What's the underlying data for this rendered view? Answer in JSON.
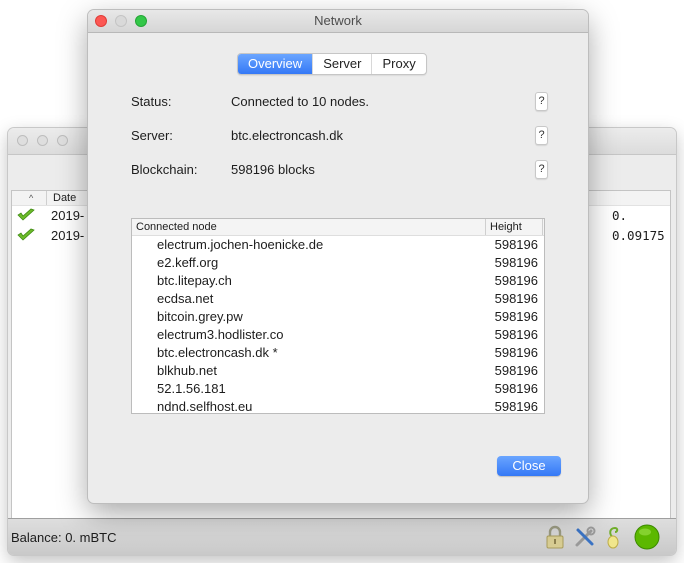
{
  "main_window": {
    "table": {
      "sort_indicator": "^",
      "columns": [
        "Date"
      ],
      "rows": [
        {
          "status_icon": "check-icon",
          "date": "2019-",
          "amount": "0."
        },
        {
          "status_icon": "check-icon",
          "date": "2019-",
          "amount": "0.09175"
        }
      ]
    },
    "status_bar": {
      "balance": "Balance: 0. mBTC",
      "icons": [
        "lock-icon",
        "tools-icon",
        "seed-icon",
        "network-status-icon"
      ]
    }
  },
  "dialog": {
    "title": "Network",
    "tabs": [
      {
        "label": "Overview",
        "active": true
      },
      {
        "label": "Server",
        "active": false
      },
      {
        "label": "Proxy",
        "active": false
      }
    ],
    "info": [
      {
        "label": "Status:",
        "value": "Connected to 10 nodes.",
        "help": "?"
      },
      {
        "label": "Server:",
        "value": "btc.electroncash.dk",
        "help": "?"
      },
      {
        "label": "Blockchain:",
        "value": "598196 blocks",
        "help": "?"
      }
    ],
    "nodes_table": {
      "columns": [
        "Connected node",
        "Height"
      ],
      "rows": [
        {
          "node": "electrum.jochen-hoenicke.de",
          "height": "598196"
        },
        {
          "node": "e2.keff.org",
          "height": "598196"
        },
        {
          "node": "btc.litepay.ch",
          "height": "598196"
        },
        {
          "node": "ecdsa.net",
          "height": "598196"
        },
        {
          "node": "bitcoin.grey.pw",
          "height": "598196"
        },
        {
          "node": "electrum3.hodlister.co",
          "height": "598196"
        },
        {
          "node": "btc.electroncash.dk *",
          "height": "598196"
        },
        {
          "node": "blkhub.net",
          "height": "598196"
        },
        {
          "node": "52.1.56.181",
          "height": "598196"
        },
        {
          "node": "ndnd.selfhost.eu",
          "height": "598196"
        }
      ]
    },
    "close_label": "Close"
  },
  "colors": {
    "accent": "#3478f6",
    "traffic_close": "#fc5753",
    "traffic_max": "#33c748",
    "status_green": "#5cb800"
  }
}
